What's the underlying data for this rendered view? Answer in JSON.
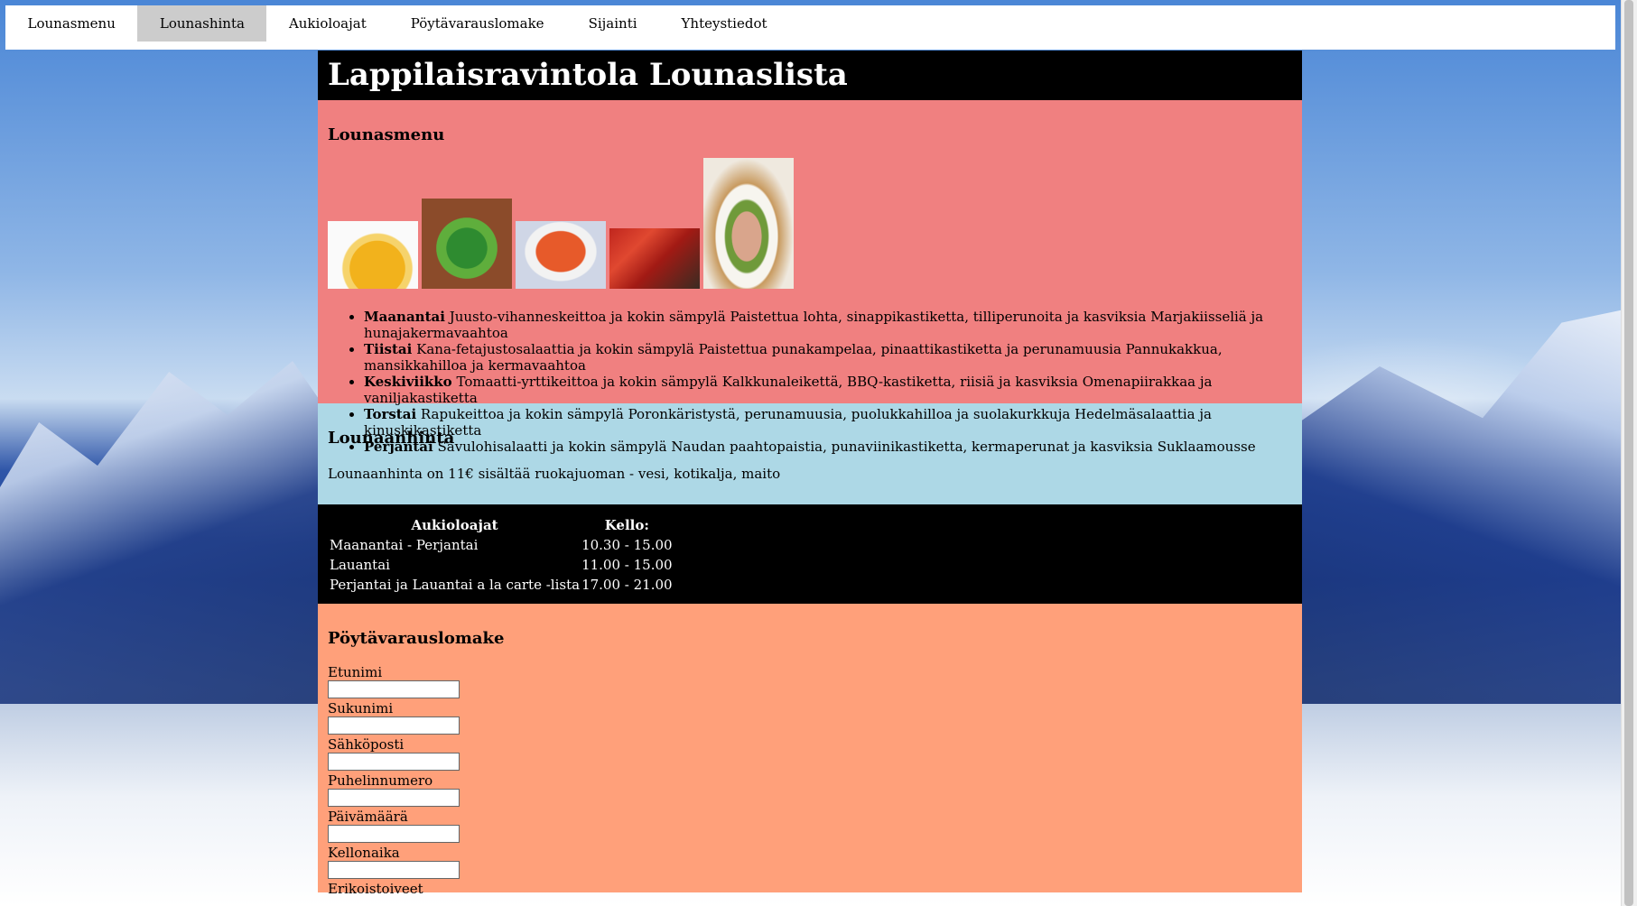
{
  "nav": {
    "items": [
      "Lounasmenu",
      "Lounashinta",
      "Aukioloajat",
      "Pöytävarauslomake",
      "Sijainti",
      "Yhteystiedot"
    ],
    "active_index": 1
  },
  "header": {
    "title": "Lappilaisravintola Lounaslista"
  },
  "menu": {
    "heading": "Lounasmenu",
    "days": [
      {
        "day": "Maanantai",
        "text": "Juusto-vihanneskeittoa ja kokin sämpylä Paistettua lohta, sinappikastiketta, tilliperunoita ja kasviksia Marjakiisseliä ja hunajakermavaahtoa"
      },
      {
        "day": "Tiistai",
        "text": "Kana-fetajustosalaattia ja kokin sämpylä Paistettua punakampelaa, pinaattikastiketta ja perunamuusia Pannukakkua, mansikkahilloa ja kermavaahtoa"
      },
      {
        "day": "Keskiviikko",
        "text": "Tomaatti-yrttikeittoa ja kokin sämpylä Kalkkunaleikettä, BBQ-kastiketta, riisiä ja kasviksia Omenapiirakkaa ja vaniljakastiketta"
      },
      {
        "day": "Torstai",
        "text": "Rapukeittoa ja kokin sämpylä Poronkäristystä, perunamuusia, puolukkahilloa ja suolakurkkuja Hedelmäsalaattia ja kinuskikastiketta"
      },
      {
        "day": "Perjantai",
        "text": "Savulohisalaatti ja kokin sämpylä Naudan paahtopaistia, punaviinikastiketta, kermaperunat ja kasviksia Suklaamousse"
      }
    ]
  },
  "price": {
    "heading": "Lounaanhinta",
    "text": "Lounaanhinta on 11€ sisältää ruokajuoman - vesi, kotikalja, maito"
  },
  "hours": {
    "headers": [
      "Aukioloajat",
      "Kello:"
    ],
    "rows": [
      [
        "Maanantai - Perjantai",
        "10.30 - 15.00"
      ],
      [
        "Lauantai",
        "11.00 - 15.00"
      ],
      [
        "Perjantai ja Lauantai a la carte -lista",
        "17.00 - 21.00"
      ]
    ]
  },
  "form": {
    "heading": "Pöytävarauslomake",
    "fields": [
      "Etunimi",
      "Sukunimi",
      "Sähköposti",
      "Puhelinnumero",
      "Päivämäärä",
      "Kellonaika",
      "Erikoistoiveet"
    ]
  },
  "colors": {
    "menu_bg": "#f08080",
    "price_bg": "#add8e6",
    "form_bg": "#ffa07a",
    "header_bg": "#000000",
    "nav_active_bg": "#cccccc"
  }
}
